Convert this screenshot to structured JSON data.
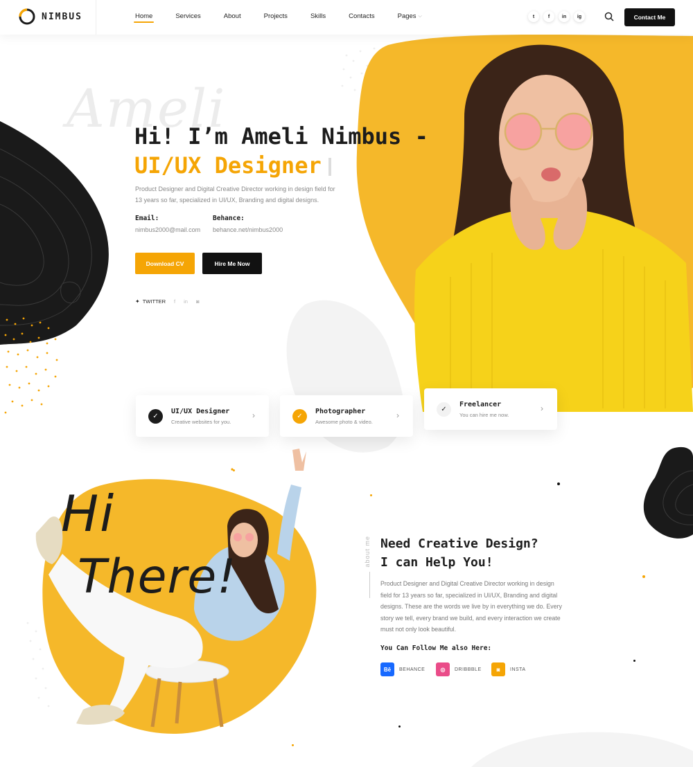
{
  "header": {
    "logo_text": "NIMBUS",
    "nav": [
      "Home",
      "Services",
      "About",
      "Projects",
      "Skills",
      "Contacts",
      "Pages"
    ],
    "socials": [
      "t",
      "f",
      "in",
      "ig"
    ],
    "contact_button": "Contact Me"
  },
  "hero": {
    "watermark": "Ameli",
    "title": "Hi! I’m Ameli Nimbus -",
    "role": "UI/UX Designer",
    "description": "Product Designer and Digital Creative Director working in design field for 13 years so far, specialized in UI/UX, Branding and digital designs.",
    "email_label": "Email:",
    "email_value": "nimbus2000@mail.com",
    "behance_label": "Behance:",
    "behance_value": "behance.net/nimbus2000",
    "download_button": "Download CV",
    "hire_button": "Hire Me Now",
    "twitter_label": "TWITTER"
  },
  "services": [
    {
      "title": "UI/UX Designer",
      "subtitle": "Creative websites for you."
    },
    {
      "title": "Photographer",
      "subtitle": "Awesome photo & video."
    },
    {
      "title": "Freelancer",
      "subtitle": "You can hire me now."
    }
  ],
  "about": {
    "side_label": "about me",
    "hand_text_1": "Hi",
    "hand_text_2": "There!",
    "title_line1": "Need Creative Design?",
    "title_line2": "I can Help You!",
    "description": "Product Designer and Digital Creative Director working in design field for 13 years so far, specialized in UI/UX, Branding and digital designs. These are the words we live by in everything we do. Every story we tell, every brand we build, and every interaction we create must not only look beautiful.",
    "follow_title": "You Can Follow Me also Here:",
    "follow": [
      {
        "icon": "Bē",
        "label": "BEHANCE",
        "color": "#1769ff"
      },
      {
        "icon": "◎",
        "label": "DRIBBBLE",
        "color": "#ea4c89"
      },
      {
        "icon": "◙",
        "label": "INSTA",
        "color": "#f5a505"
      }
    ]
  },
  "colors": {
    "accent": "#f5a505",
    "dark": "#1c1c1c"
  }
}
